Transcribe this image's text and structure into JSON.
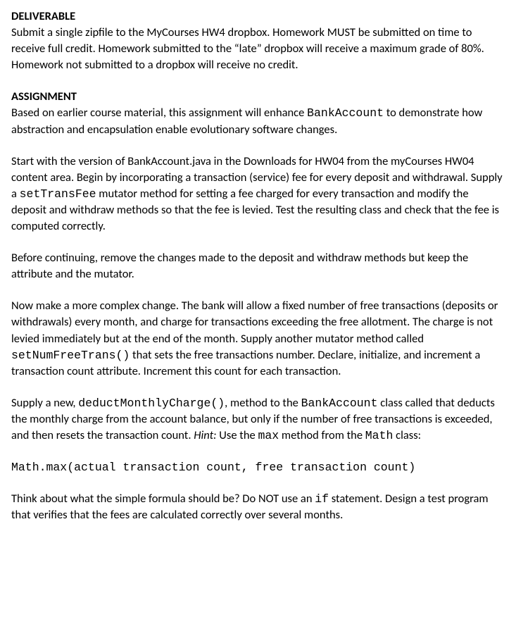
{
  "deliverable": {
    "heading": "DELIVERABLE",
    "text": "Submit a single zipfile to the MyCourses HW4 dropbox. Homework MUST be submitted on time to receive full credit. Homework submitted to the “late” dropbox will receive a maximum grade of 80%. Homework not submitted to a dropbox will receive no credit."
  },
  "assignment": {
    "heading": "ASSIGNMENT",
    "p1_a": "Based on earlier course material, this assignment will enhance ",
    "p1_code1": "BankAccount",
    "p1_b": " to demonstrate how abstraction and encapsulation enable evolutionary software changes.",
    "p2_a": "Start with the version of BankAccount.java in the Downloads for HW04 from the myCourses HW04 content area. Begin by incorporating a transaction (service) fee for every deposit and withdrawal. Supply a ",
    "p2_code1": "setTransFee",
    "p2_b": " mutator method for setting a fee charged for every transaction and modify the deposit and withdraw methods so that the fee is levied. Test the resulting class and check that the fee is computed correctly.",
    "p3": "Before continuing, remove the changes made to the deposit and withdraw methods but keep the attribute and the mutator.",
    "p4_a": "Now make a more complex change. The bank will allow a fixed number of free transactions (deposits or withdrawals) every month, and charge for transactions exceeding the free allotment. The charge is not levied immediately but at the end of the month. Supply another mutator method called ",
    "p4_code1": "setNumFreeTrans()",
    "p4_b": " that sets the free transactions number.  Declare, initialize, and increment a transaction count attribute. Increment this count for each transaction.",
    "p5_a": "Supply a new, ",
    "p5_code1": "deductMonthlyCharge()",
    "p5_b": ", method to the ",
    "p5_code2": "BankAccount",
    "p5_c": " class called that deducts the monthly charge from the account balance, but only if the number of free transactions is exceeded, and then resets the transaction count.  ",
    "p5_hint": "Hint:",
    "p5_d": " Use the ",
    "p5_code3": "max",
    "p5_e": " method from the ",
    "p5_code4": "Math",
    "p5_f": " class:",
    "codeline": "Math.max(actual transaction count, free transaction count)",
    "p6_a": "Think about what the simple formula should be?  Do NOT use an ",
    "p6_code1": "if",
    "p6_b": " statement.  Design a test program that verifies that the fees are calculated correctly over several months."
  }
}
